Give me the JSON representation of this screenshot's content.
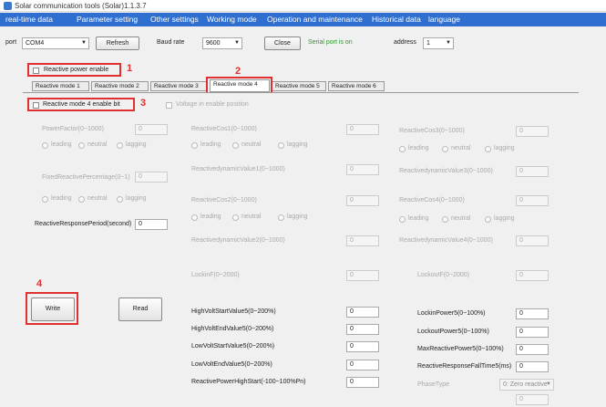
{
  "window": {
    "title": "Solar communication tools (Solar)1.1.3.7"
  },
  "menu": [
    "real-time data",
    "Parameter setting",
    "Other settings",
    "Working mode",
    "Operation and maintenance",
    "Historical data",
    "language"
  ],
  "toolbar": {
    "port_label": "port",
    "port_value": "COM4",
    "refresh_label": "Refresh",
    "baud_label": "Baud rate",
    "baud_value": "9600",
    "close_label": "Close",
    "status": "Serial port is on",
    "address_label": "address",
    "address_value": "1"
  },
  "reactive_power_enable": "Reactive power enable",
  "tabs": [
    "Reactive mode 1",
    "Reactive mode 2",
    "Reactive mode 3",
    "Reactive mode 4",
    "Reactive mode 5",
    "Reactive mode 6"
  ],
  "mode4_enable": "Reactive mode 4 enable bit",
  "voltage_enable": "Voltage in enable position",
  "radio": {
    "leading": "leading",
    "neutral": "neutral",
    "lagging": "lagging"
  },
  "fields": {
    "power_factor": "PowerFactor(0~1000)",
    "power_factor_value": "0",
    "fixed_reactive": "FixedReactivePercentage(0~1)",
    "fixed_reactive_value": "0",
    "response_period": "ReactiveResponsePeriod(second)",
    "response_period_value": "0",
    "col1": "ReactiveCos1(0~1000)",
    "col1_v": "0",
    "dyn1": "ReactivedynamicValue1(0~1000)",
    "dyn1_v": "0",
    "col2": "ReactiveCos2(0~1000)",
    "col2_v": "0",
    "dyn2": "ReactivedynamicValue2(0~1000)",
    "dyn2_v": "0",
    "col3": "ReactiveCos3(0~1000)",
    "col3_v": "0",
    "dyn3": "ReactivedynamicValue3(0~1000)",
    "dyn3_v": "0",
    "col4": "ReactiveCos4(0~1000)",
    "col4_v": "0",
    "dyn4": "ReactivedynamicValue4(0~1000)",
    "dyn4_v": "0",
    "lockin": "LockinF(0~2000)",
    "lockin_v": "0",
    "lockout": "LockoutF(0~2000)",
    "lockout_v": "0"
  },
  "buttons": {
    "write": "Write",
    "read": "Read"
  },
  "bottom_left": [
    {
      "label": "HighVoltStartValue5(0~200%)",
      "value": "0"
    },
    {
      "label": "HighVoltEndValue5(0~200%)",
      "value": "0"
    },
    {
      "label": "LowVoltStartValue5(0~200%)",
      "value": "0"
    },
    {
      "label": "LowVoltEndValue5(0~200%)",
      "value": "0"
    },
    {
      "label": "ReactivePowerHighStart(-100~100%Pn)",
      "value": "0"
    }
  ],
  "bottom_right": [
    {
      "label": "LockinPower5(0~100%)",
      "value": "0"
    },
    {
      "label": "LockoutPower5(0~100%)",
      "value": "0"
    },
    {
      "label": "MaxReactivePower5(0~100%)",
      "value": "0"
    },
    {
      "label": "ReactiveResponseFallTime5(ms)",
      "value": "0"
    }
  ],
  "phase_type_label": "PhaseType",
  "phase_type_value": "0: Zero reactive",
  "extra_value": "0",
  "annotations": [
    "1",
    "2",
    "3",
    "4"
  ]
}
